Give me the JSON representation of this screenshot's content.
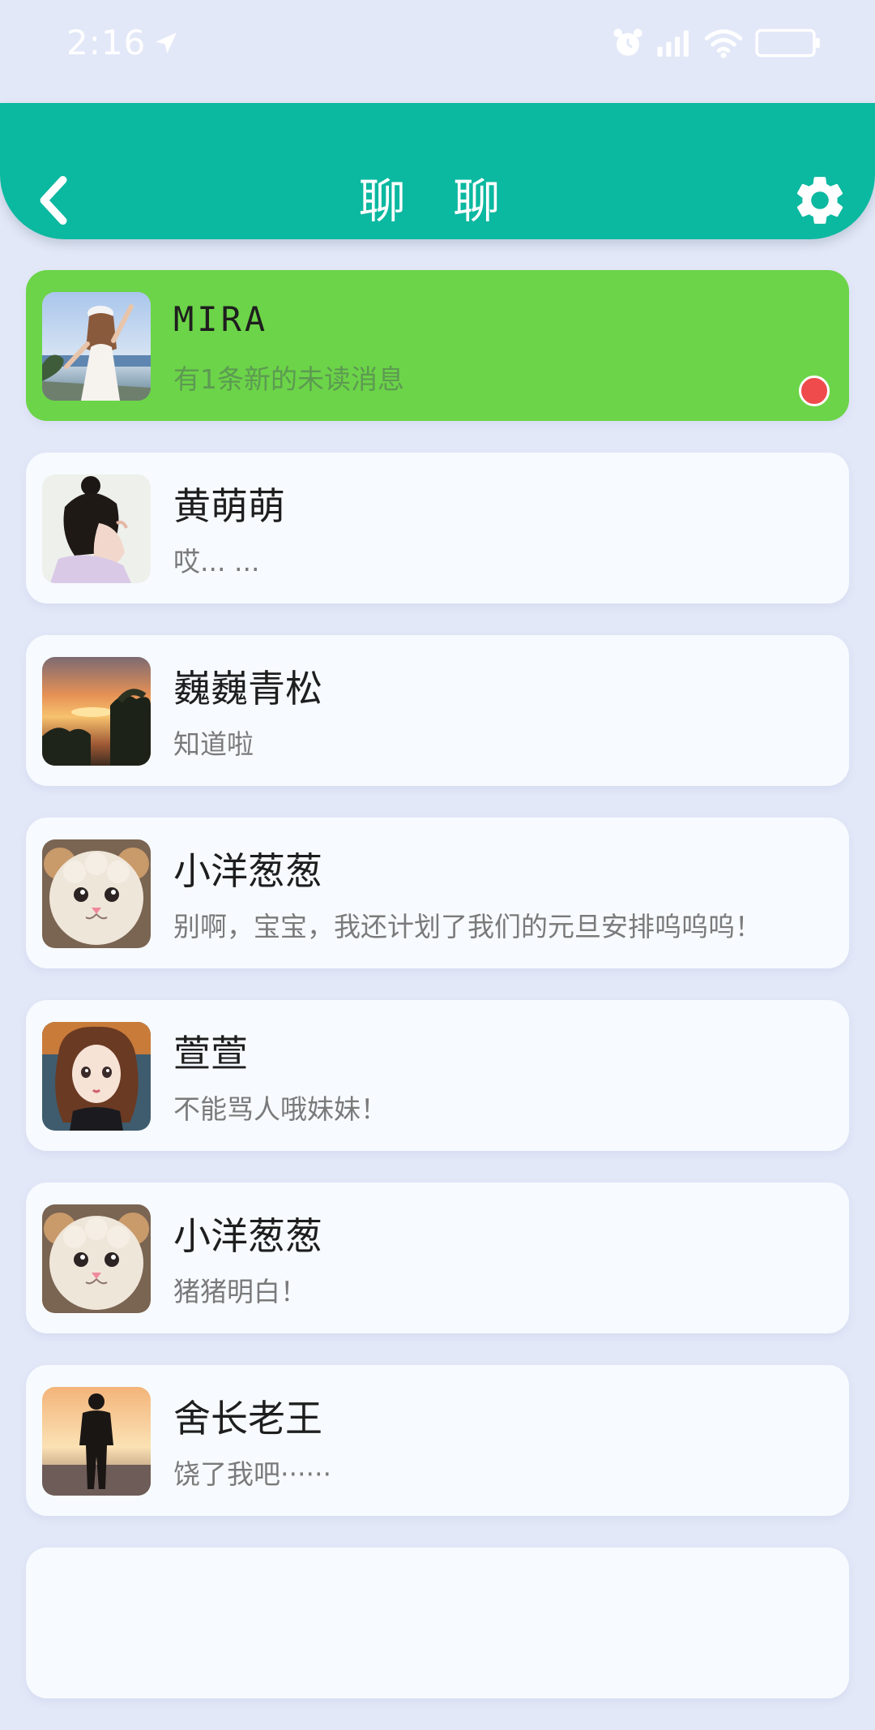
{
  "status_bar": {
    "time": "2:16",
    "icons": [
      "location-arrow-icon",
      "alarm-icon",
      "signal-icon",
      "wifi-icon",
      "battery-icon"
    ]
  },
  "header": {
    "title": "聊 聊",
    "back_icon": "chevron-left-icon",
    "settings_icon": "gear-icon",
    "background_color": "#0bb8a0"
  },
  "colors": {
    "page_background": "#e3e8f8",
    "active_item": "#6cd448",
    "unread_dot": "#ef4a4c"
  },
  "chats": [
    {
      "name": "MIRA",
      "preview": "有1条新的未读消息",
      "unread": true,
      "avatar": "girl-seaside-photo"
    },
    {
      "name": "黄萌萌",
      "preview": "哎... ...",
      "unread": false,
      "avatar": "girl-portrait-photo"
    },
    {
      "name": "巍巍青松",
      "preview": "知道啦",
      "unread": false,
      "avatar": "sunset-photo"
    },
    {
      "name": "小洋葱葱",
      "preview": "别啊，宝宝，我还计划了我们的元旦安排呜呜呜！",
      "unread": false,
      "avatar": "sheep-cat-photo"
    },
    {
      "name": "萱萱",
      "preview": "不能骂人哦妹妹！",
      "unread": false,
      "avatar": "cartoon-girl-photo"
    },
    {
      "name": "小洋葱葱",
      "preview": "猪猪明白！",
      "unread": false,
      "avatar": "sheep-cat-photo"
    },
    {
      "name": "舍长老王",
      "preview": "饶了我吧······",
      "unread": false,
      "avatar": "man-silhouette-sunset-photo"
    }
  ]
}
